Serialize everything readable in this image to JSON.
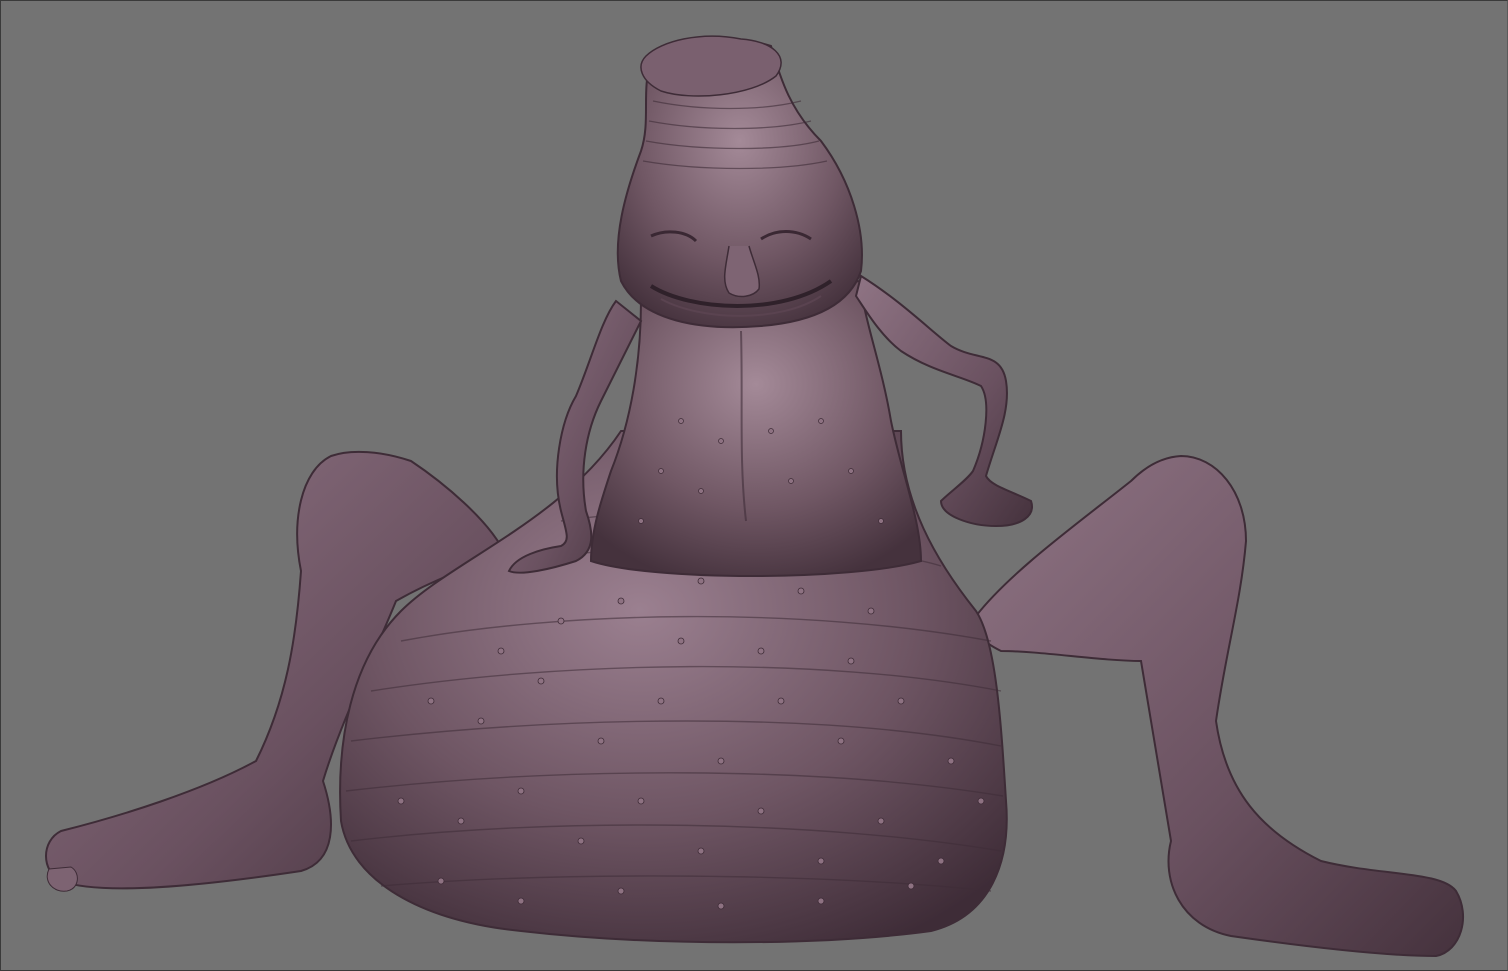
{
  "viewport": {
    "background": "#737373",
    "border_color": "#3a3a3a"
  },
  "model": {
    "description_icon": "sculpt-model-icon",
    "material_color": "#6e5563",
    "highlight_color": "#a88e9c",
    "shadow_color": "#3e2c37"
  }
}
